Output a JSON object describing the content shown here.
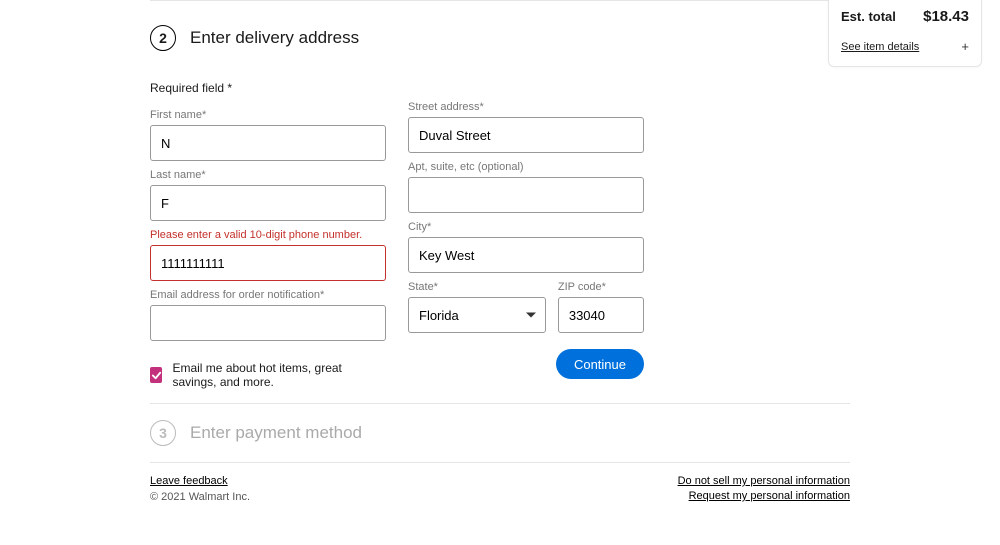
{
  "summary": {
    "est_label": "Est. total",
    "total": "$18.43",
    "details_label": "See item details"
  },
  "step2": {
    "number": "2",
    "title": "Enter delivery address"
  },
  "required_note": "Required field *",
  "fields": {
    "first_name": {
      "label": "First name*",
      "value": "N"
    },
    "last_name": {
      "label": "Last name*",
      "value": "F"
    },
    "phone_error": "Please enter a valid 10-digit phone number.",
    "phone": {
      "value": "1111111111"
    },
    "email": {
      "label": "Email address for order notification*",
      "value": ""
    },
    "street": {
      "label": "Street address*",
      "value": "Duval Street"
    },
    "apt": {
      "label": "Apt, suite, etc (optional)",
      "value": ""
    },
    "city": {
      "label": "City*",
      "value": "Key West"
    },
    "state": {
      "label": "State*",
      "value": "Florida"
    },
    "zip": {
      "label": "ZIP code*",
      "value": "33040"
    }
  },
  "email_optin": "Email me about hot items, great savings, and more.",
  "continue": "Continue",
  "step3": {
    "number": "3",
    "title": "Enter payment method"
  },
  "footer": {
    "feedback": "Leave feedback",
    "copy": "© 2021 Walmart Inc.",
    "dns": "Do not sell my personal information",
    "req": "Request my personal information"
  }
}
